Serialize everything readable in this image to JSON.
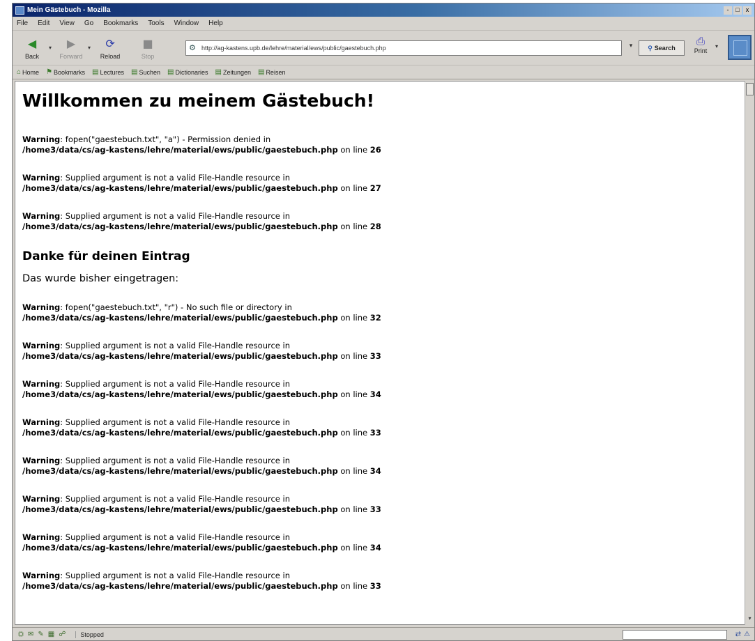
{
  "window": {
    "title": "Mein Gästebuch - Mozilla",
    "controls": [
      "-",
      "□",
      "x"
    ]
  },
  "menubar": [
    "File",
    "Edit",
    "View",
    "Go",
    "Bookmarks",
    "Tools",
    "Window",
    "Help"
  ],
  "navbar": {
    "back": "Back",
    "forward": "Forward",
    "reload": "Reload",
    "stop": "Stop",
    "url": "http://ag-kastens.upb.de/lehre/material/ews/public/gaestebuch.php",
    "search": "Search",
    "print": "Print"
  },
  "personal_toolbar": [
    "Home",
    "Bookmarks",
    "Lectures",
    "Suchen",
    "Dictionaries",
    "Zeitungen",
    "Reisen"
  ],
  "page": {
    "heading": "Willkommen zu meinem Gästebuch!",
    "warnings_top": [
      {
        "label": "Warning",
        "msg": ": fopen(\"gaestebuch.txt\", \"a\") - Permission denied in",
        "path": "/home3/data/cs/ag-kastens/lehre/material/ews/public/gaestebuch.php",
        "on": " on line ",
        "line": "26"
      },
      {
        "label": "Warning",
        "msg": ": Supplied argument is not a valid File-Handle resource in",
        "path": "/home3/data/cs/ag-kastens/lehre/material/ews/public/gaestebuch.php",
        "on": " on line ",
        "line": "27"
      },
      {
        "label": "Warning",
        "msg": ": Supplied argument is not a valid File-Handle resource in",
        "path": "/home3/data/cs/ag-kastens/lehre/material/ews/public/gaestebuch.php",
        "on": " on line ",
        "line": "28"
      }
    ],
    "thanks": "Danke für deinen Eintrag",
    "bisher": "Das wurde bisher eingetragen:",
    "warnings_bottom": [
      {
        "label": "Warning",
        "msg": ": fopen(\"gaestebuch.txt\", \"r\") - No such file or directory in",
        "path": "/home3/data/cs/ag-kastens/lehre/material/ews/public/gaestebuch.php",
        "on": " on line ",
        "line": "32"
      },
      {
        "label": "Warning",
        "msg": ": Supplied argument is not a valid File-Handle resource in",
        "path": "/home3/data/cs/ag-kastens/lehre/material/ews/public/gaestebuch.php",
        "on": " on line ",
        "line": "33"
      },
      {
        "label": "Warning",
        "msg": ": Supplied argument is not a valid File-Handle resource in",
        "path": "/home3/data/cs/ag-kastens/lehre/material/ews/public/gaestebuch.php",
        "on": " on line ",
        "line": "34"
      },
      {
        "label": "Warning",
        "msg": ": Supplied argument is not a valid File-Handle resource in",
        "path": "/home3/data/cs/ag-kastens/lehre/material/ews/public/gaestebuch.php",
        "on": " on line ",
        "line": "33"
      },
      {
        "label": "Warning",
        "msg": ": Supplied argument is not a valid File-Handle resource in",
        "path": "/home3/data/cs/ag-kastens/lehre/material/ews/public/gaestebuch.php",
        "on": " on line ",
        "line": "34"
      },
      {
        "label": "Warning",
        "msg": ": Supplied argument is not a valid File-Handle resource in",
        "path": "/home3/data/cs/ag-kastens/lehre/material/ews/public/gaestebuch.php",
        "on": " on line ",
        "line": "33"
      },
      {
        "label": "Warning",
        "msg": ": Supplied argument is not a valid File-Handle resource in",
        "path": "/home3/data/cs/ag-kastens/lehre/material/ews/public/gaestebuch.php",
        "on": " on line ",
        "line": "34"
      },
      {
        "label": "Warning",
        "msg": ": Supplied argument is not a valid File-Handle resource in",
        "path": "/home3/data/cs/ag-kastens/lehre/material/ews/public/gaestebuch.php",
        "on": " on line ",
        "line": "33"
      }
    ]
  },
  "statusbar": {
    "status": "Stopped"
  },
  "colors": {
    "titlebar": "#0a246a",
    "chrome": "#d6d3ce",
    "content_bg": "#ffffff"
  }
}
